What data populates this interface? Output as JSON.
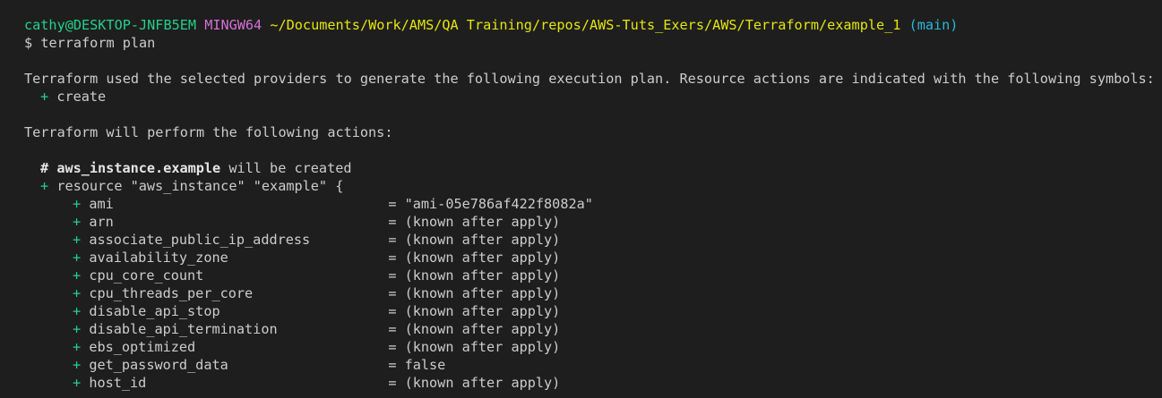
{
  "prompt": {
    "user_host": "cathy@DESKTOP-JNFB5EM",
    "msystem": "MINGW64",
    "cwd": "~/Documents/Work/AMS/QA Training/repos/AWS-Tuts_Exers/AWS/Terraform/example_1",
    "branch": "(main)",
    "symbol": "$",
    "command": "terraform plan"
  },
  "output": {
    "intro": "Terraform used the selected providers to generate the following execution plan. Resource actions are indicated with the following symbols:",
    "legend_symbol": "+",
    "legend_label": "create",
    "actions_header": "Terraform will perform the following actions:",
    "resource_comment_hash": "#",
    "resource_address": "aws_instance.example",
    "resource_status": "will be created",
    "resource_decl": "resource \"aws_instance\" \"example\" {"
  },
  "attributes": [
    {
      "sym": "+",
      "name": "ami",
      "value": "= \"ami-05e786af422f8082a\""
    },
    {
      "sym": "+",
      "name": "arn",
      "value": "= (known after apply)"
    },
    {
      "sym": "+",
      "name": "associate_public_ip_address",
      "value": "= (known after apply)"
    },
    {
      "sym": "+",
      "name": "availability_zone",
      "value": "= (known after apply)"
    },
    {
      "sym": "+",
      "name": "cpu_core_count",
      "value": "= (known after apply)"
    },
    {
      "sym": "+",
      "name": "cpu_threads_per_core",
      "value": "= (known after apply)"
    },
    {
      "sym": "+",
      "name": "disable_api_stop",
      "value": "= (known after apply)"
    },
    {
      "sym": "+",
      "name": "disable_api_termination",
      "value": "= (known after apply)"
    },
    {
      "sym": "+",
      "name": "ebs_optimized",
      "value": "= (known after apply)"
    },
    {
      "sym": "+",
      "name": "get_password_data",
      "value": "= false"
    },
    {
      "sym": "+",
      "name": "host_id",
      "value": "= (known after apply)"
    }
  ],
  "colors": {
    "background": "#1e1e1e",
    "text": "#cccccc",
    "green": "#23d18b",
    "magenta": "#d670d6",
    "yellow": "#e5e510",
    "cyan": "#29b8db"
  }
}
